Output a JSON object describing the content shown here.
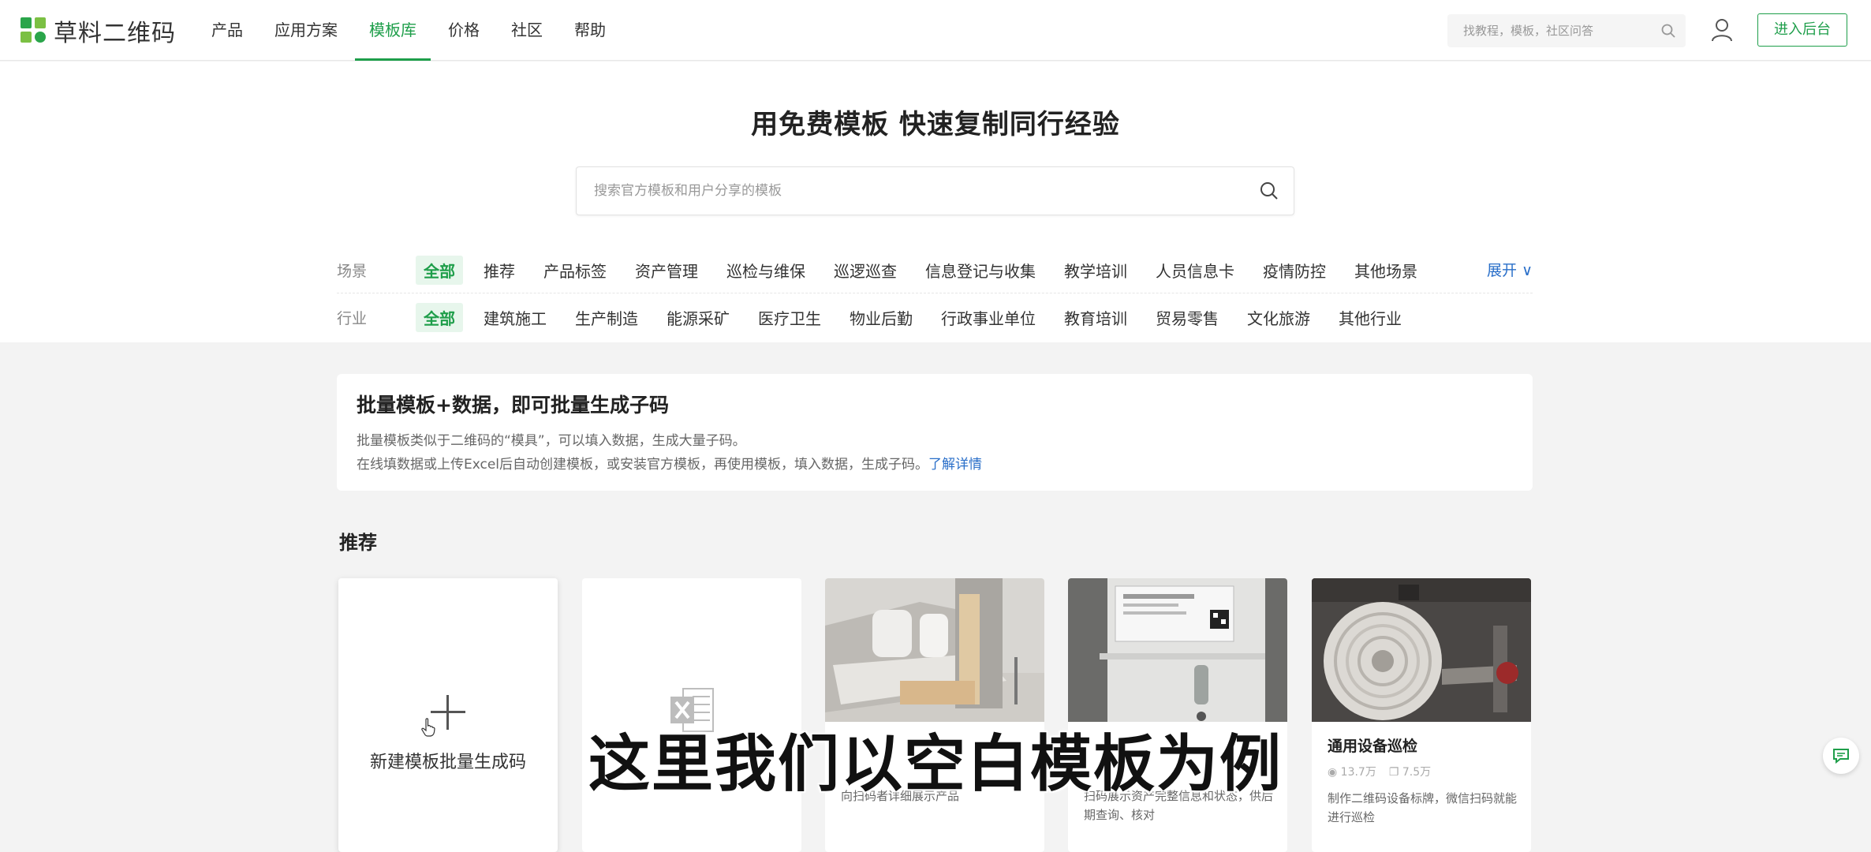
{
  "brand": {
    "name": "草料二维码",
    "accent": "#1e9e4a"
  },
  "nav": {
    "items": [
      {
        "label": "产品"
      },
      {
        "label": "应用方案"
      },
      {
        "label": "模板库",
        "active": true
      },
      {
        "label": "价格"
      },
      {
        "label": "社区"
      },
      {
        "label": "帮助"
      }
    ],
    "search_placeholder": "找教程，模板，社区问答",
    "enter_button": "进入后台"
  },
  "hero": {
    "title": "用免费模板 快速复制同行经验",
    "search_placeholder": "搜索官方模板和用户分享的模板"
  },
  "filters": {
    "scene": {
      "label": "场景",
      "options": [
        "全部",
        "推荐",
        "产品标签",
        "资产管理",
        "巡检与维保",
        "巡逻巡查",
        "信息登记与收集",
        "教学培训",
        "人员信息卡",
        "疫情防控",
        "其他场景"
      ],
      "selected": "全部",
      "expand_label": "展开"
    },
    "industry": {
      "label": "行业",
      "options": [
        "全部",
        "建筑施工",
        "生产制造",
        "能源采矿",
        "医疗卫生",
        "物业后勤",
        "行政事业单位",
        "教育培训",
        "贸易零售",
        "文化旅游",
        "其他行业"
      ],
      "selected": "全部"
    }
  },
  "info_banner": {
    "title": "批量模板+数据，即可批量生成子码",
    "line1": "批量模板类似于二维码的“模具”，可以填入数据，生成大量子码。",
    "line2": "在线填数据或上传Excel后自动创建模板，或安装官方模板，再使用模板，填入数据，生成子码。",
    "link": "了解详情"
  },
  "recommend": {
    "title": "推荐",
    "new_card_label": "新建模板批量生成码",
    "cards": [
      {
        "title": "",
        "views": "",
        "copies": "",
        "desc": ""
      },
      {
        "title": "",
        "views": "",
        "copies": "",
        "desc": "向扫码者详细展示产品",
        "icon": "sofa-image"
      },
      {
        "title": "",
        "views": "",
        "copies": "",
        "desc": "扫码展示资产完整信息和状态，供后期查询、核对",
        "icon": "machine-image"
      },
      {
        "title": "通用设备巡检",
        "views": "13.7万",
        "copies": "7.5万",
        "desc": "制作二维码设备标牌，微信扫码就能进行巡检",
        "icon": "fire-hose-image"
      }
    ]
  },
  "subtitle": "这里我们以空白模板为例"
}
